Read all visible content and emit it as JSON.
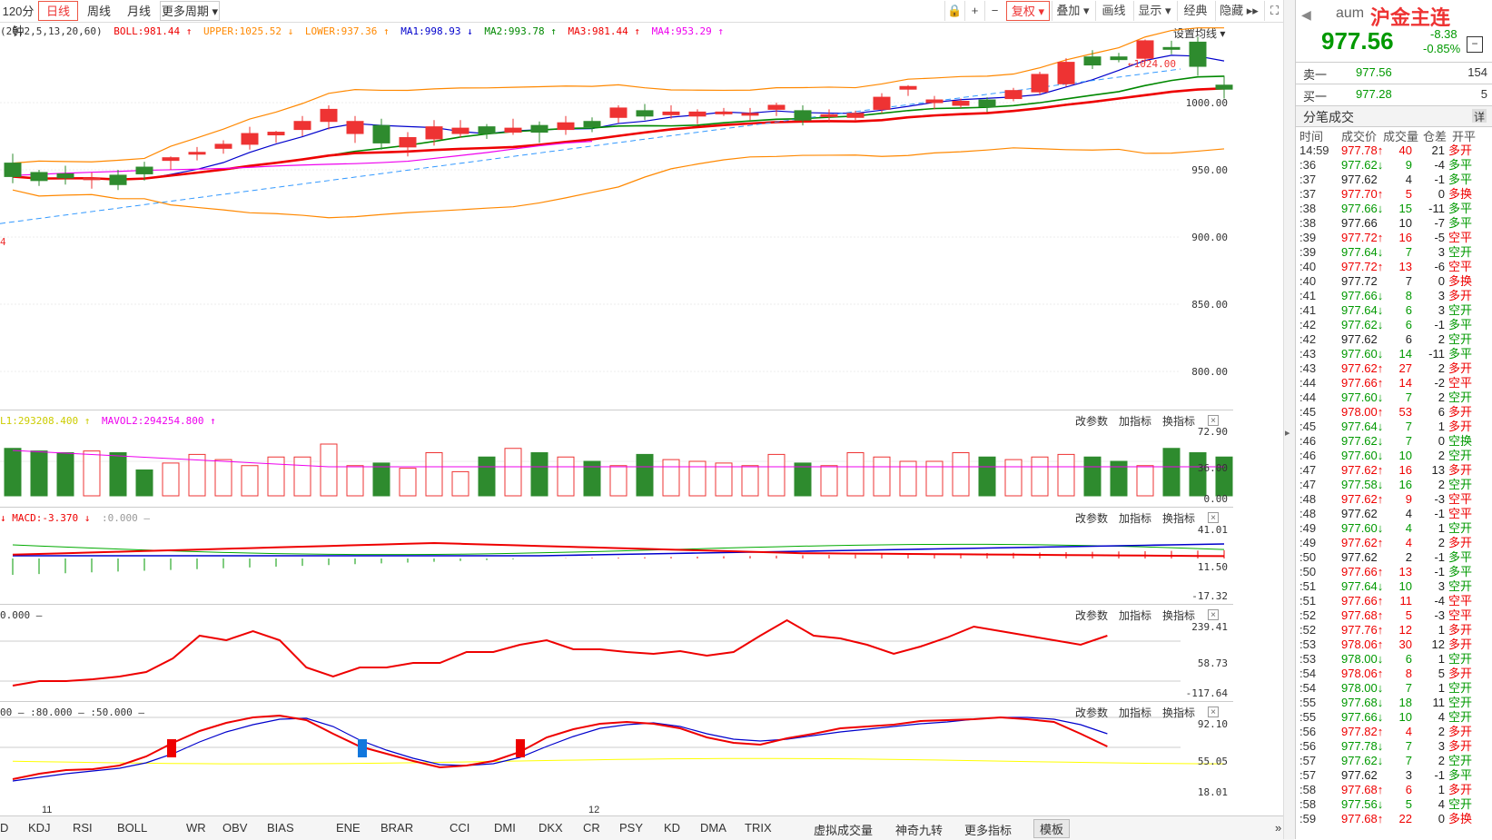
{
  "toolbar": {
    "periods": [
      "120分钟",
      "日线",
      "周线",
      "月线",
      "更多周期 ▾"
    ],
    "active_period": "日线",
    "buttons": [
      "复权 ▾",
      "叠加 ▾",
      "画线",
      "显示 ▾",
      "经典",
      "隐藏 ▸▸"
    ],
    "active_button": "复权 ▾"
  },
  "legend": {
    "params": "(20,2,5,13,20,60)",
    "boll": "BOLL:981.44 ↑",
    "upper": "UPPER:1025.52 ↓",
    "lower": "LOWER:937.36 ↑",
    "ma1": "MA1:998.93 ↓",
    "ma2": "MA2:993.78 ↑",
    "ma3": "MA3:981.44 ↑",
    "ma4": "MA4:953.29 ↑",
    "set_ma": "设置均线 ▾"
  },
  "price_axis": [
    "1000.00",
    "950.00",
    "900.00",
    "850.00",
    "800.00"
  ],
  "annotations": {
    "high_label": "←1024.00",
    "left_marker": "4"
  },
  "vol_panel": {
    "legend1": "L1:293208.400 ↑",
    "legend2": "MAVOL2:294254.800 ↑",
    "axis": [
      "72.90",
      "36.00",
      "0.00"
    ]
  },
  "macd_panel": {
    "legend1": "↓ MACD:-3.370 ↓",
    "legend2": ":0.000 —",
    "axis": [
      "41.01",
      "11.50",
      "-17.32"
    ]
  },
  "p4_panel": {
    "legend1": "0.000 —",
    "axis": [
      "239.41",
      "58.73",
      "-117.64"
    ]
  },
  "kd_panel": {
    "legend1": "00 — :80.000 — :50.000 —",
    "axis": [
      "92.10",
      "55.05",
      "18.01"
    ]
  },
  "panel_buttons": {
    "change": "改参数",
    "add": "加指标",
    "swap": "换指标",
    "close": "×"
  },
  "x_labels": {
    "a": "11",
    "b": "12"
  },
  "indicator_tabs": [
    "D",
    "KDJ",
    "RSI",
    "BOLL",
    "WR",
    "OBV",
    "BIAS",
    "ENE",
    "BRAR",
    "CCI",
    "DMI",
    "DKX",
    "CR",
    "PSY",
    "KD",
    "DMA",
    "TRIX",
    "虚拟成交量",
    "神奇九转",
    "更多指标",
    "模板"
  ],
  "active_tab": "模板",
  "quote": {
    "code": "aum",
    "name": "沪金主连",
    "price": "977.56",
    "change": "-8.38",
    "change_pct": "-0.85%",
    "sell_label": "卖一",
    "sell_price": "977.56",
    "sell_vol": "154",
    "buy_label": "买一",
    "buy_price": "977.28",
    "buy_vol": "5",
    "trades_title": "分笔成交",
    "detail": "详",
    "headers": [
      "时间",
      "成交价",
      "成交量",
      "仓差",
      "开平"
    ]
  },
  "trades": [
    [
      "14:59",
      "977.78",
      "↑",
      "40",
      "21",
      "多开",
      "r"
    ],
    [
      ":36",
      "977.62",
      "↓",
      "9",
      "-4",
      "多平",
      "g"
    ],
    [
      ":37",
      "977.62",
      "",
      "4",
      "-1",
      "多平",
      "g"
    ],
    [
      ":37",
      "977.70",
      "↑",
      "5",
      "0",
      "多换",
      "r"
    ],
    [
      ":38",
      "977.66",
      "↓",
      "15",
      "-11",
      "多平",
      "g"
    ],
    [
      ":38",
      "977.66",
      "",
      "10",
      "-7",
      "多平",
      "g"
    ],
    [
      ":39",
      "977.72",
      "↑",
      "16",
      "-5",
      "空平",
      "r"
    ],
    [
      ":39",
      "977.64",
      "↓",
      "7",
      "3",
      "空开",
      "g"
    ],
    [
      ":40",
      "977.72",
      "↑",
      "13",
      "-6",
      "空平",
      "r"
    ],
    [
      ":40",
      "977.72",
      "",
      "7",
      "0",
      "多换",
      "r"
    ],
    [
      ":41",
      "977.66",
      "↓",
      "8",
      "3",
      "多开",
      "r"
    ],
    [
      ":41",
      "977.64",
      "↓",
      "6",
      "3",
      "空开",
      "g"
    ],
    [
      ":42",
      "977.62",
      "↓",
      "6",
      "-1",
      "多平",
      "g"
    ],
    [
      ":42",
      "977.62",
      "",
      "6",
      "2",
      "空开",
      "g"
    ],
    [
      ":43",
      "977.60",
      "↓",
      "14",
      "-11",
      "多平",
      "g"
    ],
    [
      ":43",
      "977.62",
      "↑",
      "27",
      "2",
      "多开",
      "r"
    ],
    [
      ":44",
      "977.66",
      "↑",
      "14",
      "-2",
      "空平",
      "r"
    ],
    [
      ":44",
      "977.60",
      "↓",
      "7",
      "2",
      "空开",
      "g"
    ],
    [
      ":45",
      "978.00",
      "↑",
      "53",
      "6",
      "多开",
      "r"
    ],
    [
      ":45",
      "977.64",
      "↓",
      "7",
      "1",
      "多开",
      "r"
    ],
    [
      ":46",
      "977.62",
      "↓",
      "7",
      "0",
      "空换",
      "g"
    ],
    [
      ":46",
      "977.60",
      "↓",
      "10",
      "2",
      "空开",
      "g"
    ],
    [
      ":47",
      "977.62",
      "↑",
      "16",
      "13",
      "多开",
      "r"
    ],
    [
      ":47",
      "977.58",
      "↓",
      "16",
      "2",
      "空开",
      "g"
    ],
    [
      ":48",
      "977.62",
      "↑",
      "9",
      "-3",
      "空平",
      "r"
    ],
    [
      ":48",
      "977.62",
      "",
      "4",
      "-1",
      "空平",
      "r"
    ],
    [
      ":49",
      "977.60",
      "↓",
      "4",
      "1",
      "空开",
      "g"
    ],
    [
      ":49",
      "977.62",
      "↑",
      "4",
      "2",
      "多开",
      "r"
    ],
    [
      ":50",
      "977.62",
      "",
      "2",
      "-1",
      "多平",
      "g"
    ],
    [
      ":50",
      "977.66",
      "↑",
      "13",
      "-1",
      "多平",
      "g"
    ],
    [
      ":51",
      "977.64",
      "↓",
      "10",
      "3",
      "空开",
      "g"
    ],
    [
      ":51",
      "977.66",
      "↑",
      "11",
      "-4",
      "空平",
      "r"
    ],
    [
      ":52",
      "977.68",
      "↑",
      "5",
      "-3",
      "空平",
      "r"
    ],
    [
      ":52",
      "977.76",
      "↑",
      "12",
      "1",
      "多开",
      "r"
    ],
    [
      ":53",
      "978.06",
      "↑",
      "30",
      "12",
      "多开",
      "r"
    ],
    [
      ":53",
      "978.00",
      "↓",
      "6",
      "1",
      "空开",
      "g"
    ],
    [
      ":54",
      "978.06",
      "↑",
      "8",
      "5",
      "多开",
      "r"
    ],
    [
      ":54",
      "978.00",
      "↓",
      "7",
      "1",
      "空开",
      "g"
    ],
    [
      ":55",
      "977.68",
      "↓",
      "18",
      "11",
      "空开",
      "g"
    ],
    [
      ":55",
      "977.66",
      "↓",
      "10",
      "4",
      "空开",
      "g"
    ],
    [
      ":56",
      "977.82",
      "↑",
      "4",
      "2",
      "多开",
      "r"
    ],
    [
      ":56",
      "977.78",
      "↓",
      "7",
      "3",
      "多开",
      "r"
    ],
    [
      ":57",
      "977.62",
      "↓",
      "7",
      "2",
      "空开",
      "g"
    ],
    [
      ":57",
      "977.62",
      "",
      "3",
      "-1",
      "多平",
      "g"
    ],
    [
      ":58",
      "977.68",
      "↑",
      "6",
      "1",
      "多开",
      "r"
    ],
    [
      ":58",
      "977.56",
      "↓",
      "5",
      "4",
      "空开",
      "g"
    ],
    [
      ":59",
      "977.68",
      "↑",
      "22",
      "0",
      "多换",
      "r"
    ]
  ],
  "candles": [
    [
      955,
      945,
      962,
      940
    ],
    [
      948,
      942,
      950,
      938
    ],
    [
      947,
      944,
      953,
      939
    ],
    [
      944,
      944,
      948,
      936
    ],
    [
      946,
      939,
      950,
      935
    ],
    [
      952,
      947,
      956,
      942
    ],
    [
      957,
      959,
      960,
      950
    ],
    [
      963,
      963,
      967,
      957
    ],
    [
      966,
      969,
      972,
      962
    ],
    [
      969,
      977,
      982,
      965
    ],
    [
      976,
      978,
      979,
      970
    ],
    [
      980,
      986,
      990,
      975
    ],
    [
      986,
      995,
      998,
      980
    ],
    [
      977,
      986,
      990,
      970
    ],
    [
      983,
      970,
      988,
      965
    ],
    [
      967,
      974,
      978,
      960
    ],
    [
      973,
      982,
      987,
      968
    ],
    [
      977,
      981,
      987,
      974
    ],
    [
      982,
      977,
      984,
      973
    ],
    [
      978,
      981,
      988,
      976
    ],
    [
      983,
      978,
      986,
      970
    ],
    [
      980,
      985,
      990,
      976
    ],
    [
      986,
      982,
      989,
      978
    ],
    [
      989,
      996,
      998,
      985
    ],
    [
      994,
      990,
      999,
      987
    ],
    [
      991,
      993,
      998,
      988
    ],
    [
      990,
      993,
      995,
      984
    ],
    [
      993,
      993,
      996,
      990
    ],
    [
      991,
      992,
      996,
      987
    ],
    [
      995,
      998,
      1000,
      990
    ],
    [
      994,
      987,
      998,
      983
    ],
    [
      990,
      991,
      995,
      985
    ],
    [
      989,
      992,
      994,
      986
    ],
    [
      995,
      1004,
      1007,
      992
    ],
    [
      1010,
      1012,
      1013,
      1005
    ],
    [
      1000,
      1002,
      1005,
      995
    ],
    [
      998,
      1001,
      1003,
      996
    ],
    [
      1002,
      997,
      1004,
      993
    ],
    [
      1003,
      1009,
      1011,
      1001
    ],
    [
      1008,
      1021,
      1023,
      1006
    ],
    [
      1014,
      1030,
      1033,
      1012
    ],
    [
      1034,
      1028,
      1039,
      1025
    ],
    [
      1034,
      1032,
      1037,
      1030
    ],
    [
      1033,
      1046,
      1047,
      1030
    ],
    [
      1041,
      1040,
      1046,
      1036
    ],
    [
      1045,
      1027,
      1049,
      1020
    ],
    [
      1013,
      1010,
      1020,
      1003
    ]
  ],
  "volumes": [
    55,
    52,
    50,
    52,
    50,
    30,
    38,
    48,
    42,
    35,
    45,
    45,
    60,
    35,
    38,
    32,
    50,
    28,
    45,
    55,
    50,
    45,
    40,
    35,
    48,
    42,
    40,
    38,
    35,
    48,
    38,
    35,
    50,
    45,
    40,
    40,
    50,
    45,
    42,
    45,
    48,
    45,
    40,
    35,
    55,
    50,
    45
  ],
  "colors": {
    "up": "#e33",
    "down": "#2e8b2e",
    "boll": "#f80",
    "mid": "#e00",
    "ma1": "#00c",
    "ma2": "#080",
    "ma4": "#e0e"
  }
}
